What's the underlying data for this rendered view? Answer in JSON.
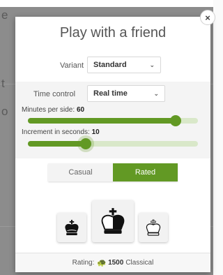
{
  "modal": {
    "title": "Play with a friend",
    "close_glyph": "×",
    "variant": {
      "label": "Variant",
      "value": "Standard"
    },
    "time_control": {
      "label": "Time control",
      "value": "Real time"
    },
    "minutes": {
      "label": "Minutes per side:",
      "value": "60",
      "fraction": 0.87
    },
    "increment": {
      "label": "Increment in seconds:",
      "value": "10",
      "fraction": 0.34
    },
    "modes": {
      "casual": "Casual",
      "rated": "Rated",
      "selected": "Rated"
    },
    "colors": {
      "black_icon": "black-king-icon",
      "random_icon": "random-king-icon",
      "white_icon": "white-king-icon"
    },
    "rating": {
      "prefix": "Rating:",
      "value": "1500",
      "suffix": "Classical",
      "icon": "turtle-icon"
    }
  },
  "colors": {
    "accent": "#629924",
    "accent_light": "#d9e8c9"
  }
}
